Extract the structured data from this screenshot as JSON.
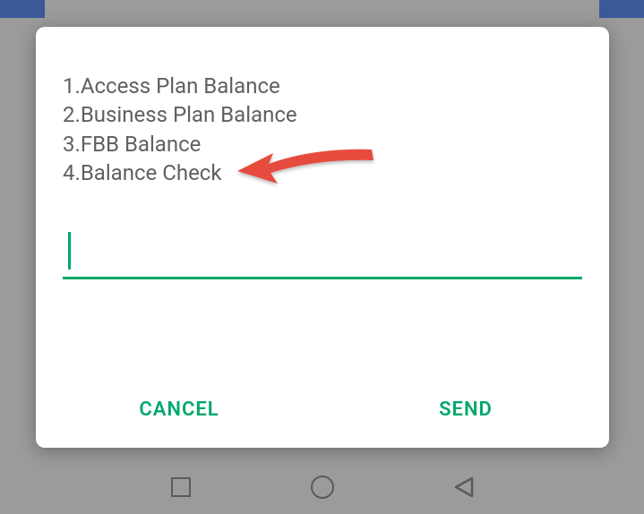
{
  "dialog": {
    "menu": [
      {
        "num": "1",
        "label": "Access Plan Balance"
      },
      {
        "num": "2",
        "label": "Business Plan Balance"
      },
      {
        "num": "3",
        "label": "FBB Balance"
      },
      {
        "num": "4",
        "label": "Balance Check"
      }
    ],
    "input": {
      "value": "",
      "placeholder": ""
    },
    "actions": {
      "cancel": "CANCEL",
      "send": "SEND"
    }
  },
  "colors": {
    "accent": "#00a86b",
    "arrow": "#e74c3c"
  },
  "annotations": {
    "arrow_target": "menu.3"
  }
}
